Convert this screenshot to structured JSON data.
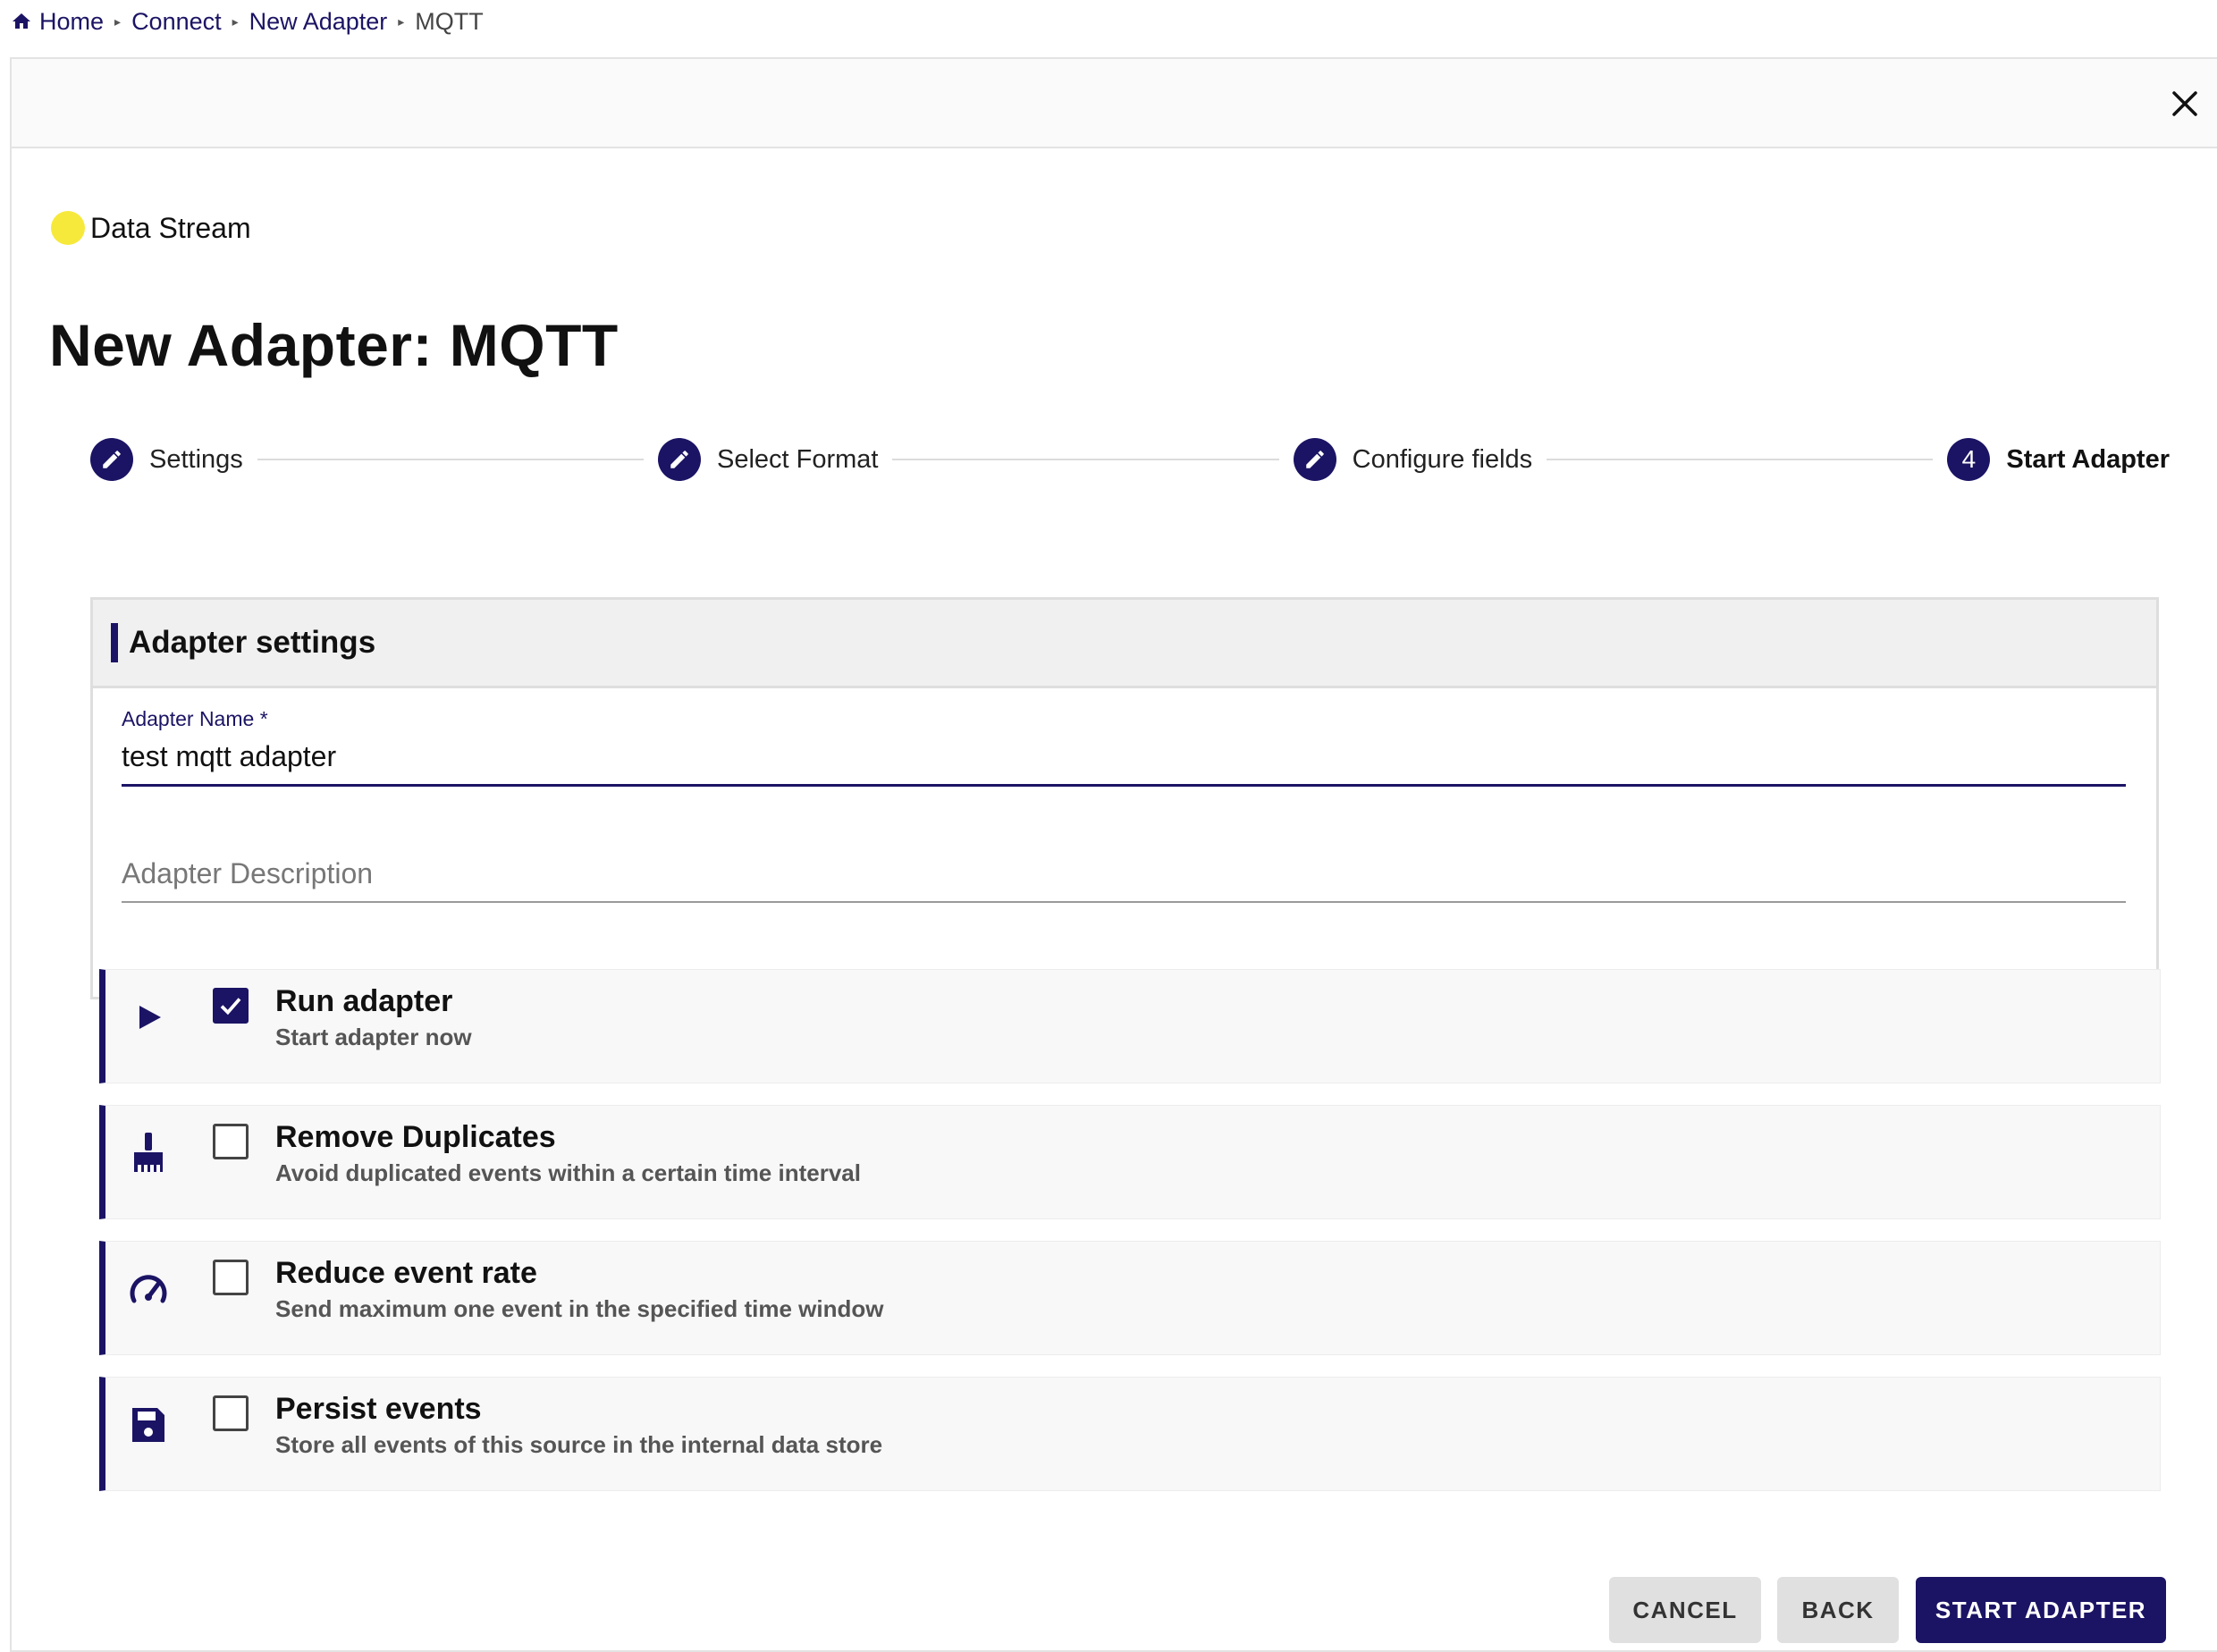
{
  "breadcrumb": {
    "home": "Home",
    "connect": "Connect",
    "new_adapter": "New Adapter",
    "current": "MQTT",
    "separator": "▸"
  },
  "header": {
    "close_icon": "close-icon"
  },
  "data_stream": {
    "label": "Data Stream",
    "dot_color": "#f7e93b"
  },
  "page": {
    "title": "New Adapter: MQTT"
  },
  "stepper": {
    "steps": [
      {
        "label": "Settings",
        "icon": "pencil-icon",
        "done": true
      },
      {
        "label": "Select Format",
        "icon": "pencil-icon",
        "done": true
      },
      {
        "label": "Configure fields",
        "icon": "pencil-icon",
        "done": true
      },
      {
        "label": "Start Adapter",
        "number": "4",
        "active": true
      }
    ]
  },
  "settings": {
    "heading": "Adapter settings",
    "name_label": "Adapter Name *",
    "name_value": "test mqtt adapter",
    "description_placeholder": "Adapter Description"
  },
  "options": [
    {
      "title": "Run adapter",
      "description": "Start adapter now",
      "checked": true,
      "icon": "play-icon"
    },
    {
      "title": "Remove Duplicates",
      "description": "Avoid duplicated events within a certain time interval",
      "checked": false,
      "icon": "broom-icon"
    },
    {
      "title": "Reduce event rate",
      "description": "Send maximum one event in the specified time window",
      "checked": false,
      "icon": "speedometer-icon"
    },
    {
      "title": "Persist events",
      "description": "Store all events of this source in the internal data store",
      "checked": false,
      "icon": "save-icon"
    }
  ],
  "buttons": {
    "cancel": "CANCEL",
    "back": "BACK",
    "start": "START ADAPTER"
  },
  "colors": {
    "primary": "#1b1464",
    "accent_dot": "#f7e93b",
    "panel_bg": "#f8f8f8"
  }
}
